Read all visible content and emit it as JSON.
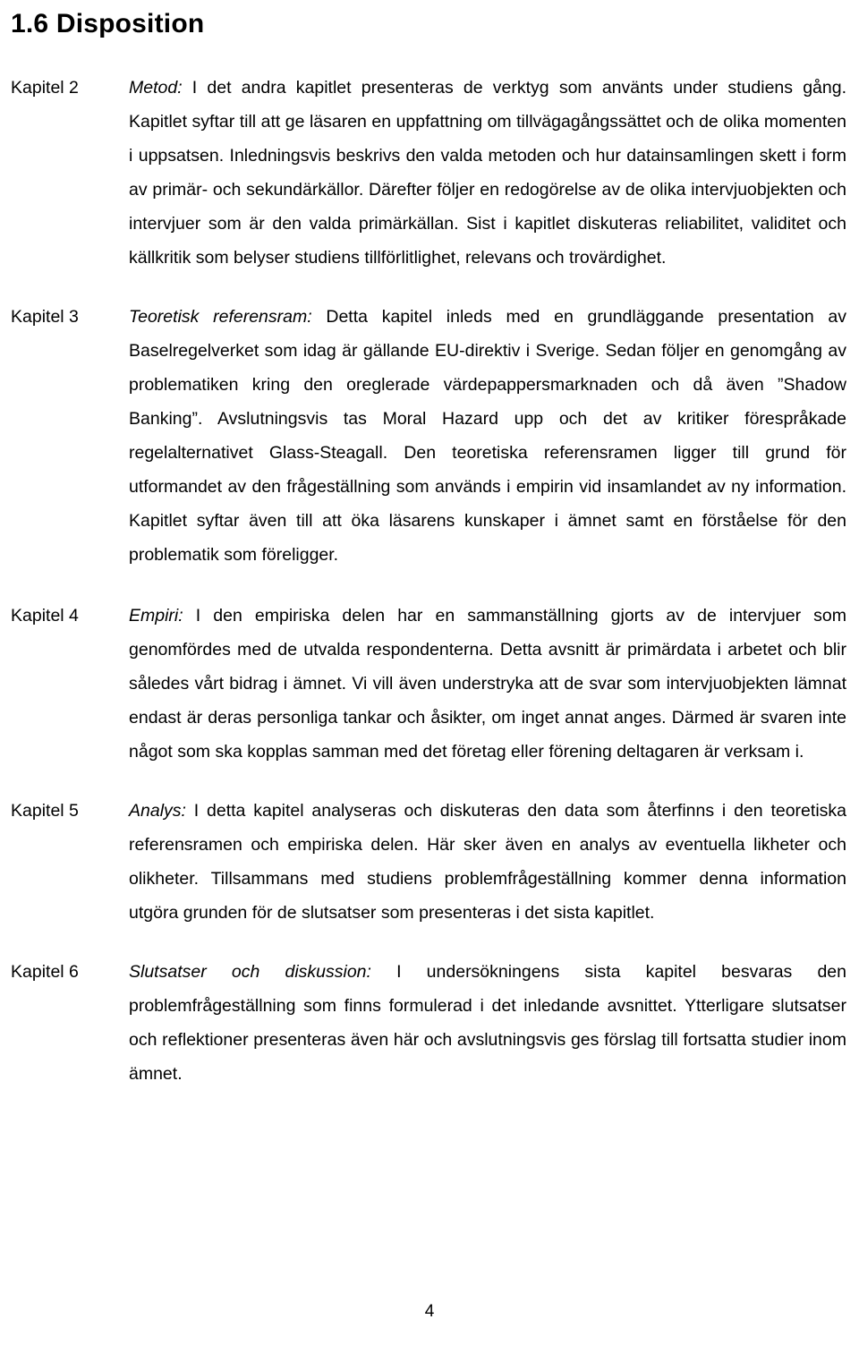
{
  "document": {
    "heading": "1.6 Disposition",
    "page_number": "4",
    "sections": [
      {
        "label": "Kapitel 2",
        "lead": "Metod:",
        "text": " I det andra kapitlet presenteras de verktyg som använts under studiens gång. Kapitlet syftar till att ge läsaren en uppfattning om tillvägagångssättet och de olika momenten i uppsatsen. Inledningsvis beskrivs den valda metoden och hur datainsamlingen skett i form av primär- och sekundärkällor. Därefter följer en redogörelse av de olika intervjuobjekten och intervjuer som är den valda primärkällan. Sist i kapitlet diskuteras reliabilitet, validitet och källkritik som belyser studiens tillförlitlighet, relevans och trovärdighet."
      },
      {
        "label": "Kapitel 3",
        "lead": "Teoretisk referensram:",
        "text": " Detta kapitel inleds med en grundläggande presentation av Baselregelverket som idag är gällande EU-direktiv i Sverige. Sedan följer en genomgång av problematiken kring den oreglerade värdepappersmarknaden och då även ”Shadow Banking”. Avslutningsvis tas Moral Hazard upp och det av kritiker förespråkade regelalternativet Glass-Steagall. Den teoretiska referensramen ligger till grund för utformandet av den frågeställning som används i empirin vid insamlandet av ny information. Kapitlet syftar även till att öka läsarens kunskaper i ämnet samt en förståelse för den problematik som föreligger."
      },
      {
        "label": "Kapitel 4",
        "lead": "Empiri:",
        "text": " I den empiriska delen har en sammanställning gjorts av de intervjuer som genomfördes med de utvalda respondenterna. Detta avsnitt är primärdata i arbetet och blir således vårt bidrag i ämnet. Vi vill även understryka att de svar som intervjuobjekten lämnat endast är deras personliga tankar och åsikter, om inget annat anges. Därmed är svaren inte något som ska kopplas samman med det företag eller förening deltagaren är verksam i."
      },
      {
        "label": "Kapitel 5",
        "lead": "Analys:",
        "text": " I detta kapitel analyseras och diskuteras den data som återfinns i den teoretiska referensramen och empiriska delen. Här sker även en analys av eventuella likheter och olikheter. Tillsammans med studiens problemfrågeställning kommer denna information utgöra grunden för de slutsatser som presenteras i det sista kapitlet."
      },
      {
        "label": "Kapitel 6",
        "lead": "Slutsatser och diskussion:",
        "text": " I undersökningens sista kapitel besvaras den problemfrågeställning som finns formulerad i det inledande avsnittet. Ytterligare slutsatser och reflektioner presenteras även här och avslutningsvis ges förslag till fortsatta studier inom ämnet."
      }
    ]
  }
}
